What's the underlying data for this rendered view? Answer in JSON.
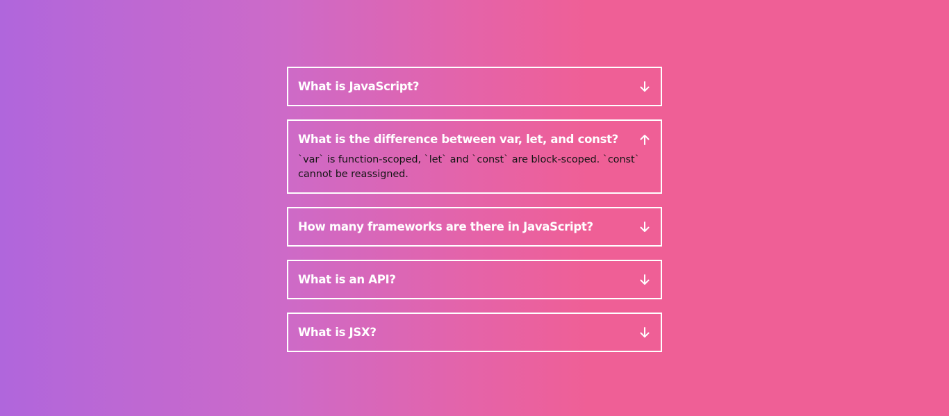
{
  "faq": {
    "items": [
      {
        "question": "What is JavaScript?",
        "open": false,
        "toggle_icon": "arrow-down-icon"
      },
      {
        "question": "What is the difference between var, let, and const?",
        "answer": "`var` is function-scoped, `let` and `const` are block-scoped. `const` cannot be reassigned.",
        "open": true,
        "toggle_icon": "arrow-up-icon"
      },
      {
        "question": "How many frameworks are there in JavaScript?",
        "open": false,
        "toggle_icon": "arrow-down-icon"
      },
      {
        "question": "What is an API?",
        "open": false,
        "toggle_icon": "arrow-down-icon"
      },
      {
        "question": "What is JSX?",
        "open": false,
        "toggle_icon": "arrow-down-icon"
      }
    ]
  },
  "colors": {
    "gradient_start": "#b066dc",
    "gradient_end": "#ef5f96",
    "border": "#ffffff",
    "answer_text": "#151515"
  }
}
